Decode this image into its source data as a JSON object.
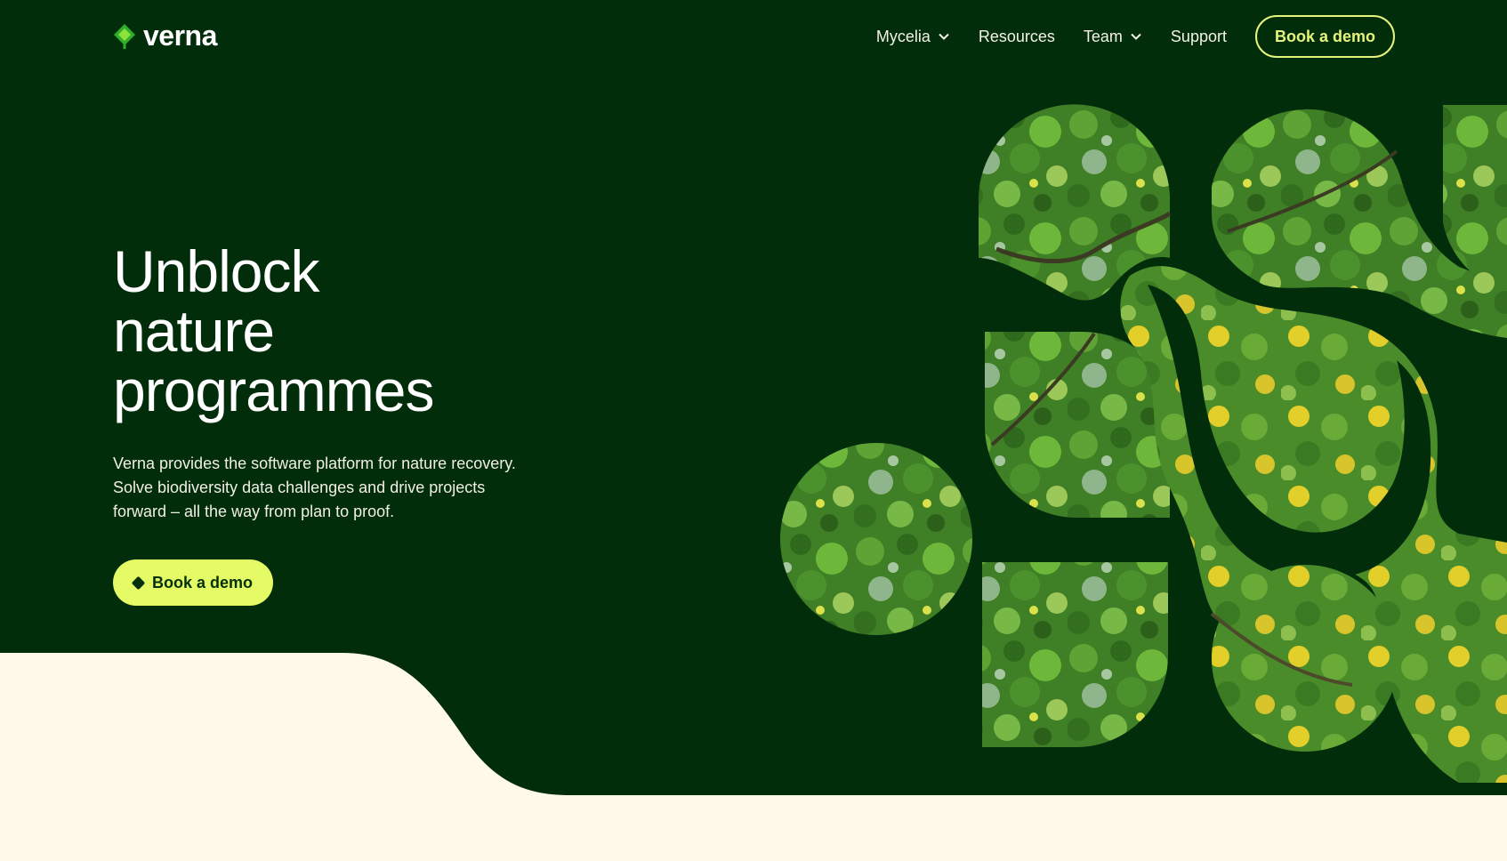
{
  "brand": {
    "name": "verna",
    "logo_icon": "leaf-diamond-icon",
    "colors": {
      "forest": "#022d0b",
      "cream": "#fff9e9",
      "lime": "#e4fb66",
      "foliage": "#4e8a2c",
      "flower": "#e6d32a"
    }
  },
  "nav": {
    "items": [
      {
        "label": "Mycelia",
        "has_dropdown": true,
        "icon": "chevron-down-icon"
      },
      {
        "label": "Resources",
        "has_dropdown": false
      },
      {
        "label": "Team",
        "has_dropdown": true,
        "icon": "chevron-down-icon"
      },
      {
        "label": "Support",
        "has_dropdown": false
      }
    ],
    "cta_label": "Book a demo"
  },
  "hero": {
    "headline_lines": [
      "Unblock",
      "nature",
      "programmes"
    ],
    "lede_lines": [
      "Verna provides the software platform for nature recovery.",
      "Solve biodiversity data challenges and drive projects",
      "forward – all the way from plan to proof."
    ],
    "cta_label": "Book a demo",
    "cta_icon": "diamond-icon",
    "image": "aerial-vegetation-mosaic"
  }
}
